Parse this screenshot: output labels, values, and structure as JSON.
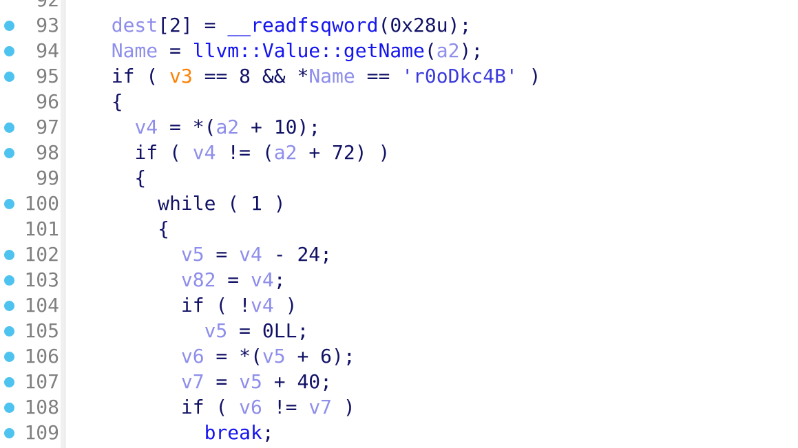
{
  "app": {
    "view": "decompiler-pseudocode",
    "title": "Pseudocode",
    "gutter_marker_icon": "breakpoint-dot-icon",
    "gutter_marker_color": "#4ec3ef",
    "line_number_color": "#808080",
    "background_color": "#ffffff"
  },
  "palette": {
    "punctuation": "#111166",
    "keyword": "#111166",
    "flow_keyword": "#1414ee",
    "function": "#1414ee",
    "variable": "#8e8eeb",
    "highlighted_variable": "#ff8000",
    "string_literal": "#3b3bdc"
  },
  "editor": {
    "first_visible_line": 92,
    "last_visible_line": 109,
    "highlighted_identifier": "v3",
    "lines": [
      {
        "number": "92",
        "has_marker": false,
        "partial": true,
        "tokens": []
      },
      {
        "number": "93",
        "has_marker": true,
        "text": "  dest[2] = __readfsqword(0x28u);",
        "tokens": [
          {
            "c": "plain",
            "t": "  "
          },
          {
            "c": "var",
            "t": "dest"
          },
          {
            "c": "plain",
            "t": "["
          },
          {
            "c": "num",
            "t": "2"
          },
          {
            "c": "plain",
            "t": "] = "
          },
          {
            "c": "func",
            "t": "__readfsqword"
          },
          {
            "c": "plain",
            "t": "("
          },
          {
            "c": "num",
            "t": "0x28u"
          },
          {
            "c": "plain",
            "t": ");"
          }
        ]
      },
      {
        "number": "94",
        "has_marker": true,
        "text": "  Name = llvm::Value::getName(a2);",
        "tokens": [
          {
            "c": "plain",
            "t": "  "
          },
          {
            "c": "var",
            "t": "Name"
          },
          {
            "c": "plain",
            "t": " = "
          },
          {
            "c": "func",
            "t": "llvm::Value::getName"
          },
          {
            "c": "plain",
            "t": "("
          },
          {
            "c": "var",
            "t": "a2"
          },
          {
            "c": "plain",
            "t": ");"
          }
        ]
      },
      {
        "number": "95",
        "has_marker": true,
        "text": "  if ( v3 == 8 && *Name == 'r0oDkc4B' )",
        "tokens": [
          {
            "c": "plain",
            "t": "  "
          },
          {
            "c": "kw",
            "t": "if"
          },
          {
            "c": "plain",
            "t": " ( "
          },
          {
            "c": "hl",
            "t": "v3"
          },
          {
            "c": "plain",
            "t": " == "
          },
          {
            "c": "num",
            "t": "8"
          },
          {
            "c": "plain",
            "t": " && *"
          },
          {
            "c": "var",
            "t": "Name"
          },
          {
            "c": "plain",
            "t": " == "
          },
          {
            "c": "str",
            "t": "'r0oDkc4B'"
          },
          {
            "c": "plain",
            "t": " )"
          }
        ]
      },
      {
        "number": "96",
        "has_marker": false,
        "text": "  {",
        "tokens": [
          {
            "c": "plain",
            "t": "  {"
          }
        ]
      },
      {
        "number": "97",
        "has_marker": true,
        "text": "    v4 = *(a2 + 10);",
        "tokens": [
          {
            "c": "plain",
            "t": "    "
          },
          {
            "c": "var",
            "t": "v4"
          },
          {
            "c": "plain",
            "t": " = *("
          },
          {
            "c": "var",
            "t": "a2"
          },
          {
            "c": "plain",
            "t": " + "
          },
          {
            "c": "num",
            "t": "10"
          },
          {
            "c": "plain",
            "t": ");"
          }
        ]
      },
      {
        "number": "98",
        "has_marker": true,
        "text": "    if ( v4 != (a2 + 72) )",
        "tokens": [
          {
            "c": "plain",
            "t": "    "
          },
          {
            "c": "kw",
            "t": "if"
          },
          {
            "c": "plain",
            "t": " ( "
          },
          {
            "c": "var",
            "t": "v4"
          },
          {
            "c": "plain",
            "t": " != ("
          },
          {
            "c": "var",
            "t": "a2"
          },
          {
            "c": "plain",
            "t": " + "
          },
          {
            "c": "num",
            "t": "72"
          },
          {
            "c": "plain",
            "t": ") )"
          }
        ]
      },
      {
        "number": "99",
        "has_marker": false,
        "text": "    {",
        "tokens": [
          {
            "c": "plain",
            "t": "    {"
          }
        ]
      },
      {
        "number": "100",
        "has_marker": true,
        "text": "      while ( 1 )",
        "tokens": [
          {
            "c": "plain",
            "t": "      "
          },
          {
            "c": "kw",
            "t": "while"
          },
          {
            "c": "plain",
            "t": " ( "
          },
          {
            "c": "num",
            "t": "1"
          },
          {
            "c": "plain",
            "t": " )"
          }
        ]
      },
      {
        "number": "101",
        "has_marker": false,
        "text": "      {",
        "tokens": [
          {
            "c": "plain",
            "t": "      {"
          }
        ]
      },
      {
        "number": "102",
        "has_marker": true,
        "text": "        v5 = v4 - 24;",
        "tokens": [
          {
            "c": "plain",
            "t": "        "
          },
          {
            "c": "var",
            "t": "v5"
          },
          {
            "c": "plain",
            "t": " = "
          },
          {
            "c": "var",
            "t": "v4"
          },
          {
            "c": "plain",
            "t": " - "
          },
          {
            "c": "num",
            "t": "24"
          },
          {
            "c": "plain",
            "t": ";"
          }
        ]
      },
      {
        "number": "103",
        "has_marker": true,
        "text": "        v82 = v4;",
        "tokens": [
          {
            "c": "plain",
            "t": "        "
          },
          {
            "c": "var",
            "t": "v82"
          },
          {
            "c": "plain",
            "t": " = "
          },
          {
            "c": "var",
            "t": "v4"
          },
          {
            "c": "plain",
            "t": ";"
          }
        ]
      },
      {
        "number": "104",
        "has_marker": true,
        "text": "        if ( !v4 )",
        "tokens": [
          {
            "c": "plain",
            "t": "        "
          },
          {
            "c": "kw",
            "t": "if"
          },
          {
            "c": "plain",
            "t": " ( !"
          },
          {
            "c": "var",
            "t": "v4"
          },
          {
            "c": "plain",
            "t": " )"
          }
        ]
      },
      {
        "number": "105",
        "has_marker": true,
        "text": "          v5 = 0LL;",
        "tokens": [
          {
            "c": "plain",
            "t": "          "
          },
          {
            "c": "var",
            "t": "v5"
          },
          {
            "c": "plain",
            "t": " = "
          },
          {
            "c": "num",
            "t": "0LL"
          },
          {
            "c": "plain",
            "t": ";"
          }
        ]
      },
      {
        "number": "106",
        "has_marker": true,
        "text": "        v6 = *(v5 + 6);",
        "tokens": [
          {
            "c": "plain",
            "t": "        "
          },
          {
            "c": "var",
            "t": "v6"
          },
          {
            "c": "plain",
            "t": " = *("
          },
          {
            "c": "var",
            "t": "v5"
          },
          {
            "c": "plain",
            "t": " + "
          },
          {
            "c": "num",
            "t": "6"
          },
          {
            "c": "plain",
            "t": ");"
          }
        ]
      },
      {
        "number": "107",
        "has_marker": true,
        "text": "        v7 = v5 + 40;",
        "tokens": [
          {
            "c": "plain",
            "t": "        "
          },
          {
            "c": "var",
            "t": "v7"
          },
          {
            "c": "plain",
            "t": " = "
          },
          {
            "c": "var",
            "t": "v5"
          },
          {
            "c": "plain",
            "t": " + "
          },
          {
            "c": "num",
            "t": "40"
          },
          {
            "c": "plain",
            "t": ";"
          }
        ]
      },
      {
        "number": "108",
        "has_marker": true,
        "text": "        if ( v6 != v7 )",
        "tokens": [
          {
            "c": "plain",
            "t": "        "
          },
          {
            "c": "kw",
            "t": "if"
          },
          {
            "c": "plain",
            "t": " ( "
          },
          {
            "c": "var",
            "t": "v6"
          },
          {
            "c": "plain",
            "t": " != "
          },
          {
            "c": "var",
            "t": "v7"
          },
          {
            "c": "plain",
            "t": " )"
          }
        ]
      },
      {
        "number": "109",
        "has_marker": true,
        "text": "          break;",
        "tokens": [
          {
            "c": "plain",
            "t": "          "
          },
          {
            "c": "flow",
            "t": "break"
          },
          {
            "c": "plain",
            "t": ";"
          }
        ]
      }
    ]
  }
}
